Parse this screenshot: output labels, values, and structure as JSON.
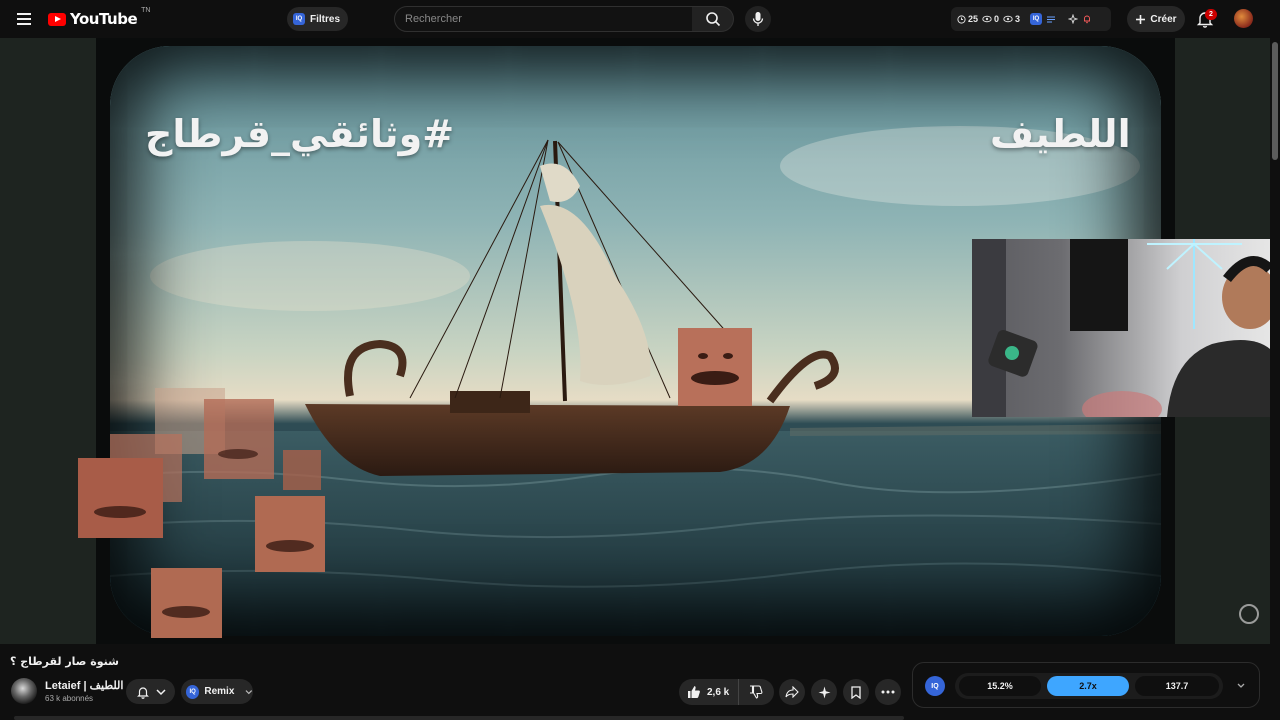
{
  "header": {
    "logo_text": "YouTube",
    "logo_sup": "TN",
    "filters_label": "Filtres",
    "iq_badge": "IQ",
    "search_placeholder": "Rechercher",
    "stats": {
      "watch_count": "25",
      "eye_count": "0",
      "view_count": "3"
    },
    "create_label": "Créer",
    "notification_count": "2"
  },
  "video": {
    "overlay_right": "اللطيف",
    "overlay_left": "#وثائقي_قرطاج",
    "title": "شنوة صار لقرطاج ؟"
  },
  "channel": {
    "name": "Letaief | اللطيف",
    "subscribers": "63 k abonnés"
  },
  "actions": {
    "remix_label": "Remix",
    "like_count": "2,6 k"
  },
  "speed_panel": {
    "iq_label": "IQ",
    "options": [
      "15.2%",
      "2.7x",
      "137.7"
    ],
    "active_index": 1
  },
  "colors": {
    "brand": "#ff0000",
    "iq_blue": "#3565d8",
    "accent": "#3ea6ff",
    "badge_red": "#cc0000"
  }
}
